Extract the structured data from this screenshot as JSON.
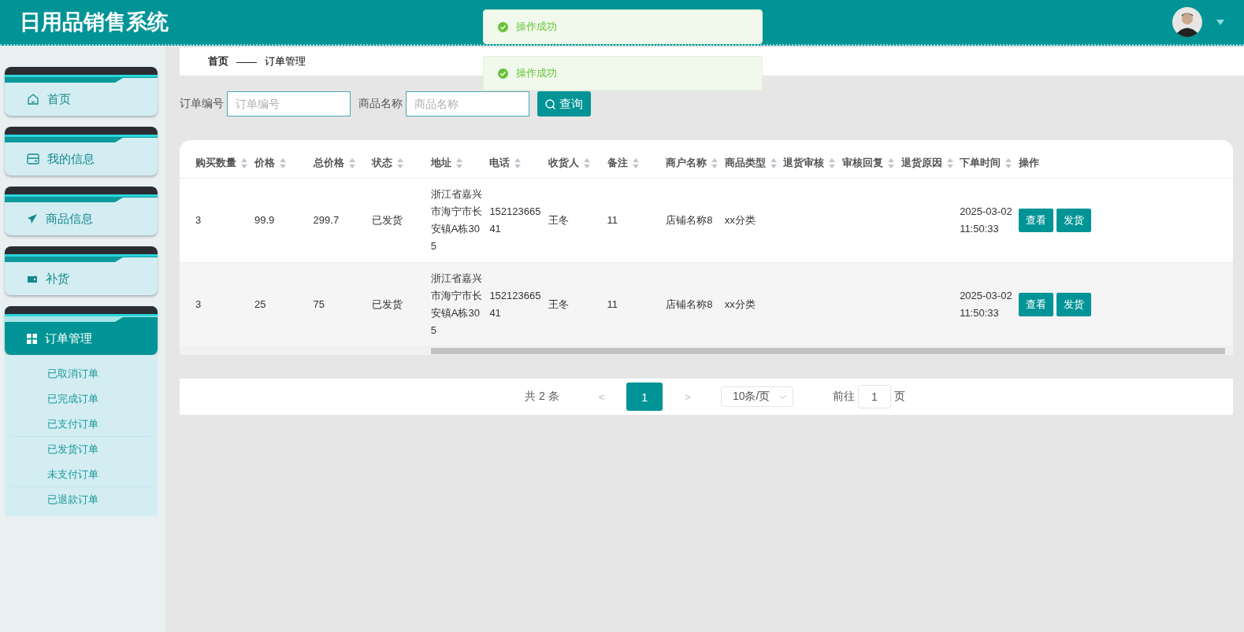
{
  "header": {
    "title": "日用品销售系统"
  },
  "toasts": [
    {
      "text": "操作成功"
    },
    {
      "text": "操作成功"
    }
  ],
  "breadcrumb": {
    "home": "首页",
    "separator": "——",
    "current": "订单管理"
  },
  "sidebar": {
    "items": [
      {
        "label": "首页",
        "selected": false
      },
      {
        "label": "我的信息",
        "selected": false
      },
      {
        "label": "商品信息",
        "selected": false
      },
      {
        "label": "补货",
        "selected": false
      },
      {
        "label": "订单管理",
        "selected": true,
        "children": [
          {
            "label": "已取消订单"
          },
          {
            "label": "已完成订单"
          },
          {
            "label": "已支付订单"
          },
          {
            "label": "已发货订单"
          },
          {
            "label": "未支付订单"
          },
          {
            "label": "已退款订单"
          }
        ]
      }
    ]
  },
  "search": {
    "fields": [
      {
        "label": "订单编号",
        "placeholder": "订单编号"
      },
      {
        "label": "商品名称",
        "placeholder": "商品名称"
      }
    ],
    "button": "查询"
  },
  "table": {
    "columns": [
      "购买数量",
      "价格",
      "总价格",
      "状态",
      "地址",
      "电话",
      "收货人",
      "备注",
      "商户名称",
      "商品类型",
      "退货审核",
      "审核回复",
      "退货原因",
      "下单时间",
      "操作"
    ],
    "rows": [
      {
        "cells": [
          "3",
          "99.9",
          "299.7",
          "已发货",
          "浙江省嘉兴市海宁市长安镇A栋305",
          "15212366541",
          "王冬",
          "11",
          "店铺名称8",
          "xx分类",
          "",
          "",
          "",
          "2025-03-02 11:50:33"
        ],
        "actions": [
          "查看",
          "发货"
        ]
      },
      {
        "cells": [
          "3",
          "25",
          "75",
          "已发货",
          "浙江省嘉兴市海宁市长安镇A栋305",
          "15212366541",
          "王冬",
          "11",
          "店铺名称8",
          "xx分类",
          "",
          "",
          "",
          "2025-03-02 11:50:33"
        ],
        "actions": [
          "查看",
          "发货"
        ]
      }
    ]
  },
  "pagination": {
    "total": "共 2 条",
    "prev": "<",
    "pages": [
      {
        "label": "1",
        "selected": true
      }
    ],
    "next": ">",
    "page_size": "10条/页",
    "goto_label": "前往",
    "goto_value": "1",
    "goto_suffix": "页"
  }
}
